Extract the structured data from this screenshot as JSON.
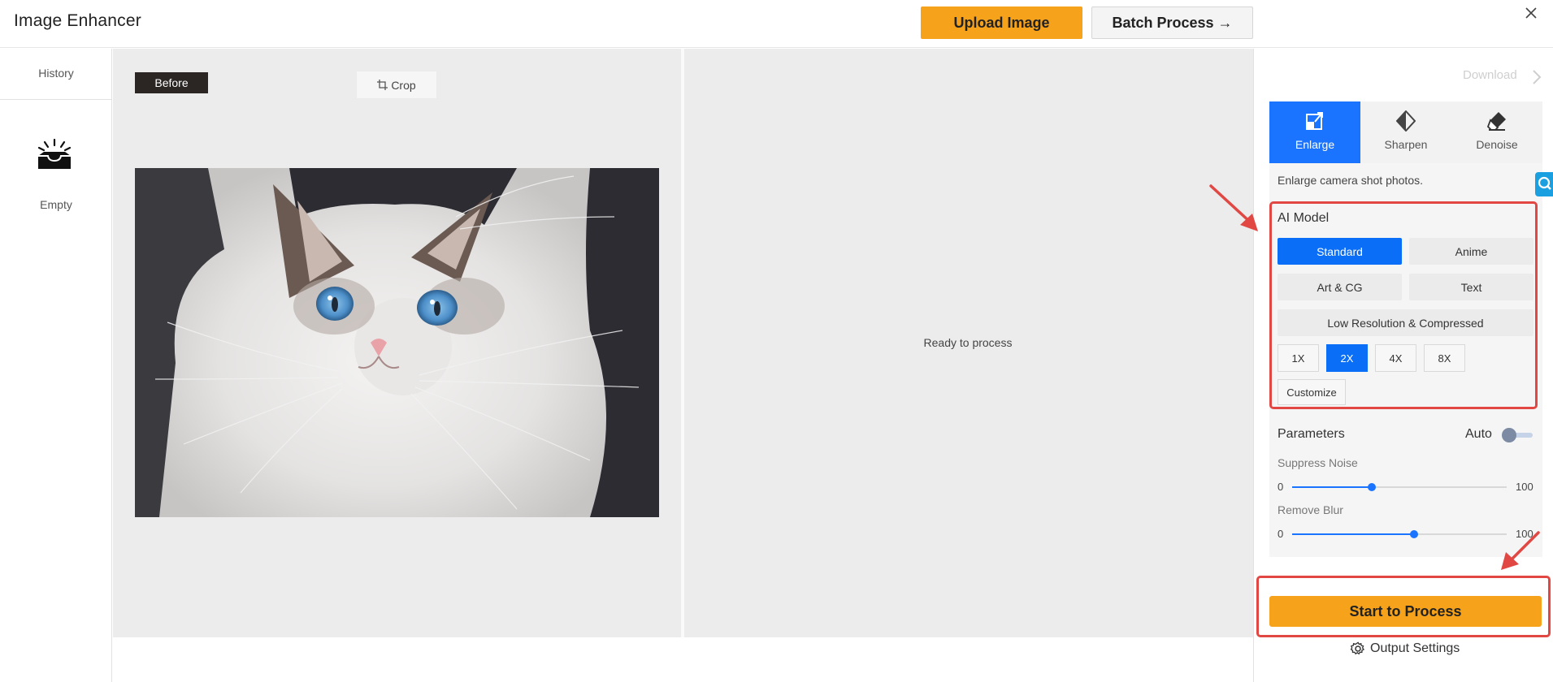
{
  "header": {
    "title": "Image Enhancer",
    "upload_label": "Upload Image",
    "batch_label": "Batch Process →"
  },
  "history": {
    "title": "History",
    "empty_label": "Empty"
  },
  "preview": {
    "before_label": "Before",
    "crop_label": "Crop",
    "result_status": "Ready to process"
  },
  "panel": {
    "download_label": "Download",
    "tabs": [
      {
        "label": "Enlarge",
        "icon": "enlarge-icon",
        "active": true
      },
      {
        "label": "Sharpen",
        "icon": "sharpen-icon",
        "active": false
      },
      {
        "label": "Denoise",
        "icon": "denoise-icon",
        "active": false
      }
    ],
    "description": "Enlarge camera shot photos.",
    "ai_model": {
      "title": "AI Model",
      "options": [
        "Standard",
        "Anime",
        "Art & CG",
        "Text",
        "Low Resolution & Compressed"
      ],
      "selected": "Standard"
    },
    "scales": [
      "1X",
      "2X",
      "4X",
      "8X"
    ],
    "selected_scale": "2X",
    "customize_label": "Customize",
    "parameters": {
      "title": "Parameters",
      "auto_label": "Auto",
      "auto_enabled": false,
      "sliders": [
        {
          "label": "Suppress Noise",
          "min": "0",
          "max": "100",
          "value": 37
        },
        {
          "label": "Remove Blur",
          "min": "0",
          "max": "100",
          "value": 57
        }
      ]
    },
    "start_label": "Start to Process",
    "output_settings_label": "Output Settings"
  },
  "colors": {
    "accent_orange": "#f7a21b",
    "accent_blue": "#1a74ff",
    "annotation_red": "#e14844"
  }
}
